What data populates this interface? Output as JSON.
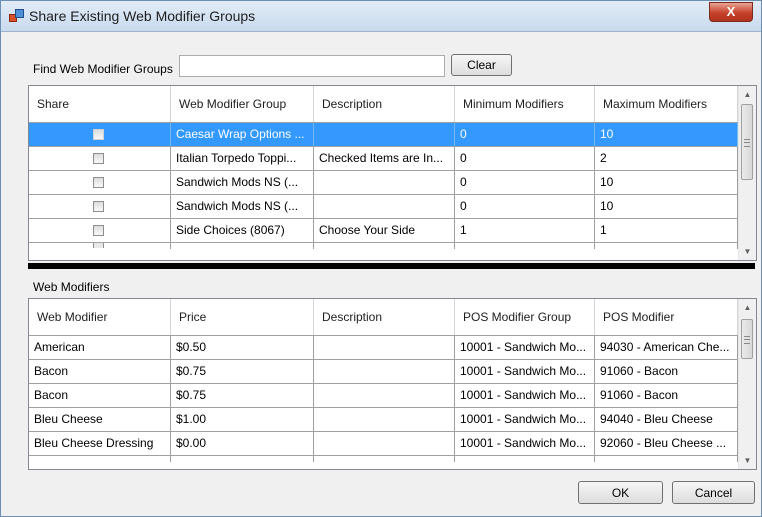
{
  "window": {
    "title": "Share Existing Web Modifier Groups",
    "close_glyph": "X"
  },
  "find": {
    "label": "Find Web Modifier Groups",
    "value": "",
    "clear_label": "Clear"
  },
  "groups_grid": {
    "headers": [
      "Share",
      "Web Modifier Group",
      "Description",
      "Minimum Modifiers",
      "Maximum Modifiers"
    ],
    "rows": [
      {
        "share": false,
        "group": "Caesar Wrap Options ...",
        "description": "",
        "min": "0",
        "max": "10",
        "selected": true
      },
      {
        "share": false,
        "group": "Italian Torpedo Toppi...",
        "description": "Checked Items are In...",
        "min": "0",
        "max": "2",
        "selected": false
      },
      {
        "share": false,
        "group": "Sandwich Mods NS (...",
        "description": "",
        "min": "0",
        "max": "10",
        "selected": false
      },
      {
        "share": false,
        "group": "Sandwich Mods NS (...",
        "description": "",
        "min": "0",
        "max": "10",
        "selected": false
      },
      {
        "share": false,
        "group": "Side Choices (8067)",
        "description": "Choose Your Side",
        "min": "1",
        "max": "1",
        "selected": false
      }
    ]
  },
  "modifiers": {
    "label": "Web Modifiers",
    "headers": [
      "Web Modifier",
      "Price",
      "Description",
      "POS Modifier Group",
      "POS Modifier"
    ],
    "rows": [
      {
        "name": "American",
        "price": "$0.50",
        "description": "",
        "pos_group": "10001 - Sandwich Mo...",
        "pos_modifier": "94030 - American Che..."
      },
      {
        "name": "Bacon",
        "price": "$0.75",
        "description": "",
        "pos_group": "10001 - Sandwich Mo...",
        "pos_modifier": "91060 - Bacon"
      },
      {
        "name": "Bacon",
        "price": "$0.75",
        "description": "",
        "pos_group": "10001 - Sandwich Mo...",
        "pos_modifier": "91060 - Bacon"
      },
      {
        "name": "Bleu Cheese",
        "price": "$1.00",
        "description": "",
        "pos_group": "10001 - Sandwich Mo...",
        "pos_modifier": "94040 - Bleu Cheese"
      },
      {
        "name": "Bleu Cheese Dressing",
        "price": "$0.00",
        "description": "",
        "pos_group": "10001 - Sandwich Mo...",
        "pos_modifier": "92060 - Bleu Cheese ..."
      }
    ]
  },
  "buttons": {
    "ok": "OK",
    "cancel": "Cancel"
  },
  "colors": {
    "selection": "#3399ff",
    "title_gradient_top": "#e2ecf7",
    "close_red": "#c7412a"
  },
  "icons": [
    "app-icon",
    "close-icon",
    "checkbox",
    "scroll-up-arrow",
    "scroll-down-arrow",
    "scrollbar-grip"
  ]
}
